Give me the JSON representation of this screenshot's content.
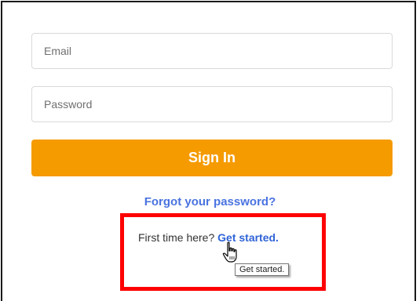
{
  "form": {
    "email_placeholder": "Email",
    "password_placeholder": "Password",
    "signin_label": "Sign In",
    "forgot_label": "Forgot your password?",
    "first_time_text": "First time here?",
    "get_started_label": "Get started.",
    "tooltip_text": "Get started."
  },
  "colors": {
    "signin_button": "#f59b00",
    "link": "#4a73e0",
    "highlight": "#ff0000"
  },
  "icons": {
    "cursor": "hand-pointer-icon"
  }
}
